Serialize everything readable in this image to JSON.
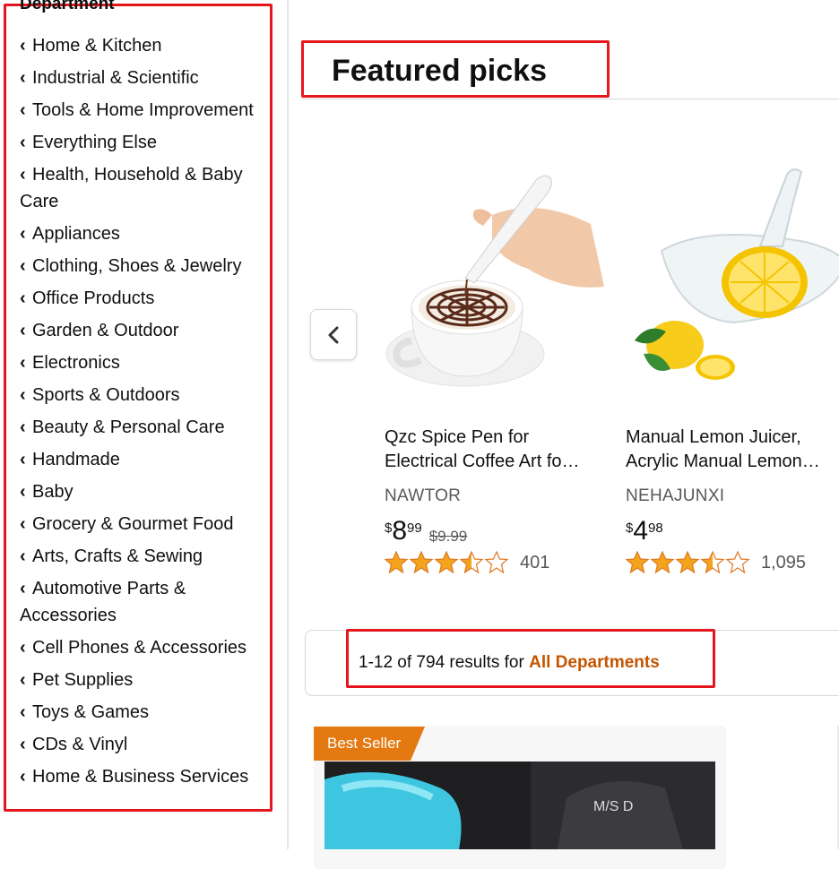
{
  "sidebar": {
    "heading": "Department",
    "items": [
      {
        "label": "Home & Kitchen"
      },
      {
        "label": "Industrial & Scientific"
      },
      {
        "label": "Tools & Home Improvement"
      },
      {
        "label": "Everything Else"
      },
      {
        "label": "Health, Household & Baby Care"
      },
      {
        "label": "Appliances"
      },
      {
        "label": "Clothing, Shoes & Jewelry"
      },
      {
        "label": "Office Products"
      },
      {
        "label": "Garden & Outdoor"
      },
      {
        "label": "Electronics"
      },
      {
        "label": "Sports & Outdoors"
      },
      {
        "label": "Beauty & Personal Care"
      },
      {
        "label": "Handmade"
      },
      {
        "label": "Baby"
      },
      {
        "label": "Grocery & Gourmet Food"
      },
      {
        "label": "Arts, Crafts & Sewing"
      },
      {
        "label": "Automotive Parts & Accessories"
      },
      {
        "label": "Cell Phones & Accessories"
      },
      {
        "label": "Pet Supplies"
      },
      {
        "label": "Toys & Games"
      },
      {
        "label": "CDs & Vinyl"
      },
      {
        "label": "Home & Business Services"
      }
    ]
  },
  "featured": {
    "title": "Featured picks",
    "prev_icon": "chevron-left-icon",
    "products": [
      {
        "title_line1": "Qzc Spice Pen for",
        "title_line2": "Electrical Coffee Art fo…",
        "brand": "NAWTOR",
        "price_symbol": "$",
        "price_whole": "8",
        "price_fraction": "99",
        "old_price": "$9.99",
        "rating": 3.5,
        "review_count": "401"
      },
      {
        "title_line1": "Manual Lemon Juicer,",
        "title_line2": "Acrylic Manual Lemon…",
        "brand": "NEHAJUNXI",
        "price_symbol": "$",
        "price_whole": "4",
        "price_fraction": "98",
        "old_price": "",
        "rating": 3.5,
        "review_count": "1,095"
      }
    ]
  },
  "results": {
    "prefix": "1-12 of 794 results for ",
    "department": "All Departments"
  },
  "product_grid": {
    "badge": "Best Seller"
  },
  "colors": {
    "highlight": "#e4171c",
    "star": "#f4a41c",
    "link_orange": "#c45500",
    "badge": "#e47911"
  }
}
